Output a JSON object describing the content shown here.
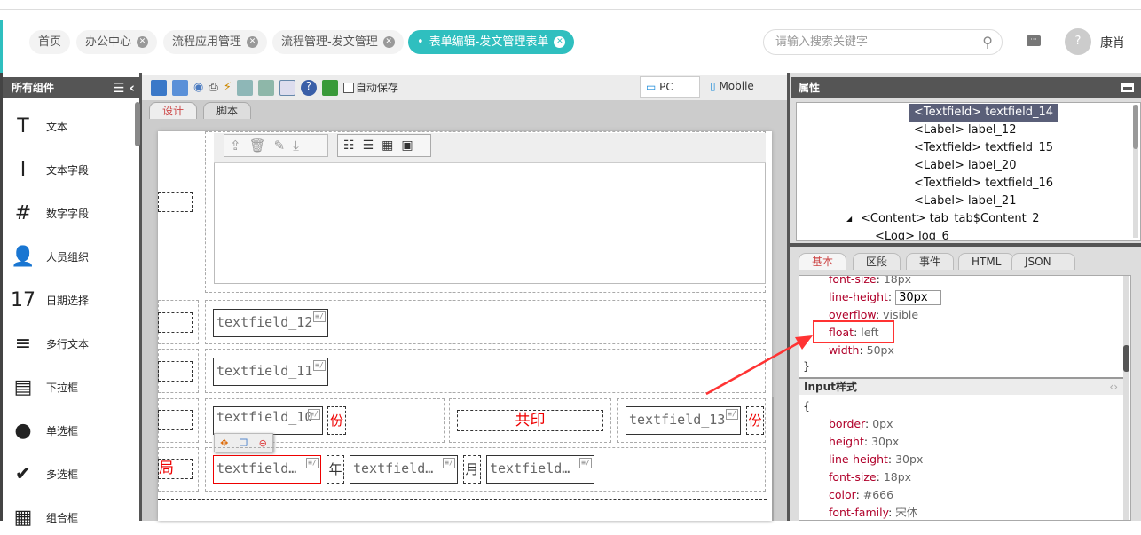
{
  "header": {
    "tabs": [
      {
        "label": "首页"
      },
      {
        "label": "办公中心"
      },
      {
        "label": "流程应用管理"
      },
      {
        "label": "流程管理-发文管理"
      },
      {
        "label": "表单编辑-发文管理表单",
        "active": true
      }
    ],
    "search_placeholder": "请输入搜索关键字",
    "user": "康肖"
  },
  "left": {
    "title": "所有组件",
    "items": [
      {
        "label": "文本",
        "icon": "T"
      },
      {
        "label": "文本字段",
        "icon": "I"
      },
      {
        "label": "数字字段",
        "icon": "#"
      },
      {
        "label": "人员组织",
        "icon": "👤"
      },
      {
        "label": "日期选择",
        "icon": "17"
      },
      {
        "label": "多行文本",
        "icon": "≡"
      },
      {
        "label": "下拉框",
        "icon": "▤"
      },
      {
        "label": "单选框",
        "icon": "●"
      },
      {
        "label": "多选框",
        "icon": "✔"
      },
      {
        "label": "组合框",
        "icon": "▦"
      }
    ]
  },
  "toolbar": {
    "autosave": "自动保存",
    "pc": "PC",
    "mobile": "Mobile"
  },
  "designer": {
    "tabs": [
      "设计",
      "脚本"
    ],
    "fields": {
      "tf12": "textfield_12",
      "tf11": "textfield_11",
      "tf10": "textfield_10",
      "fen1": "份",
      "gongyin": "共印",
      "tf13": "textfield_13",
      "fen2": "份",
      "ju": "局",
      "tfa": "textfield…",
      "nian": "年",
      "tfb": "textfield…",
      "yue": "月",
      "tfc": "textfield…"
    }
  },
  "right": {
    "title": "属性",
    "tree": [
      "<Textfield> textfield_14",
      "<Label> label_12",
      "<Textfield> textfield_15",
      "<Label> label_20",
      "<Textfield> textfield_16",
      "<Label> label_21",
      "<Content> tab_tab$Content_2",
      "<Log> log_6"
    ],
    "tabs": [
      "基本",
      "区段",
      "事件",
      "HTML",
      "JSON"
    ],
    "style1": [
      {
        "k": "font-size",
        "v": "18px"
      },
      {
        "k": "line-height",
        "v": "30px"
      },
      {
        "k": "overflow",
        "v": "visible"
      },
      {
        "k": "float",
        "v": "left"
      },
      {
        "k": "width",
        "v": "50px"
      }
    ],
    "close_brace": "}",
    "open_brace": "{",
    "input_title": "Input样式",
    "style2": [
      {
        "k": "border",
        "v": "0px"
      },
      {
        "k": "height",
        "v": "30px"
      },
      {
        "k": "line-height",
        "v": "30px"
      },
      {
        "k": "font-size",
        "v": "18px"
      },
      {
        "k": "color",
        "v": "#666"
      },
      {
        "k": "font-family",
        "v": "宋体"
      }
    ]
  },
  "colors": {
    "accent": "#2fbfbf",
    "highlight": "#ff3333"
  }
}
